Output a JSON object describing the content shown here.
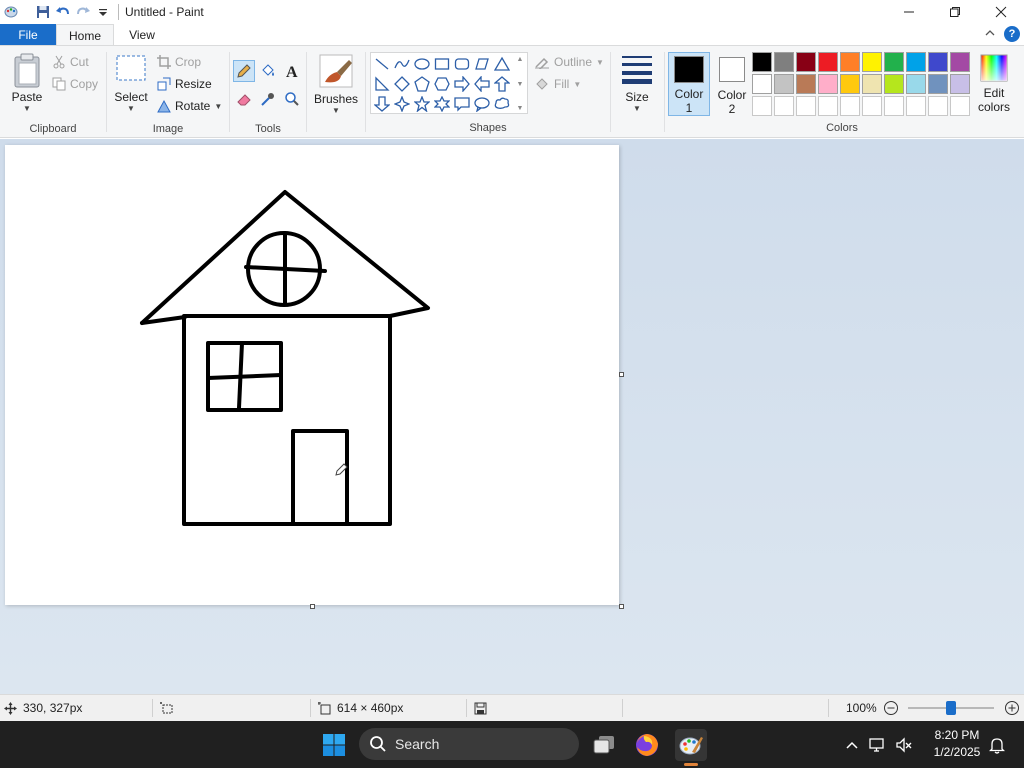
{
  "window": {
    "title": "Untitled - Paint"
  },
  "tabs": [
    {
      "label": "File"
    },
    {
      "label": "Home"
    },
    {
      "label": "View"
    }
  ],
  "ribbon": {
    "clipboard": {
      "label": "Clipboard",
      "paste": "Paste",
      "cut": "Cut",
      "copy": "Copy"
    },
    "image": {
      "label": "Image",
      "select": "Select",
      "crop": "Crop",
      "resize": "Resize",
      "rotate": "Rotate"
    },
    "tools": {
      "label": "Tools"
    },
    "brushes": {
      "label": "Brushes"
    },
    "shapes": {
      "label": "Shapes",
      "outline": "Outline",
      "fill": "Fill"
    },
    "size": {
      "label": "Size"
    },
    "color1": {
      "label1": "Color",
      "label2": "1",
      "color": "#000000"
    },
    "color2": {
      "label1": "Color",
      "label2": "2",
      "color": "#ffffff"
    },
    "colors": {
      "label": "Colors",
      "edit1": "Edit",
      "edit2": "colors"
    }
  },
  "palette": [
    "#000000",
    "#7f7f7f",
    "#880015",
    "#ed1c24",
    "#ff7f27",
    "#fff200",
    "#22b14c",
    "#00a2e8",
    "#3f48cc",
    "#a349a4",
    "#ffffff",
    "#c3c3c3",
    "#b97a57",
    "#ffaec9",
    "#ffc90e",
    "#efe4b0",
    "#b5e61d",
    "#99d9ea",
    "#7092be",
    "#c8bfe7",
    "#ffffff",
    "#ffffff",
    "#ffffff",
    "#ffffff",
    "#ffffff",
    "#ffffff",
    "#ffffff",
    "#ffffff",
    "#ffffff",
    "#ffffff"
  ],
  "status": {
    "cursor_pos": "330, 327px",
    "canvas_size": "614 × 460px",
    "zoom": "100%",
    "zoom_level": 1.0
  },
  "taskbar": {
    "search_label": "Search",
    "time": "8:20 PM",
    "date": "1/2/2025"
  }
}
